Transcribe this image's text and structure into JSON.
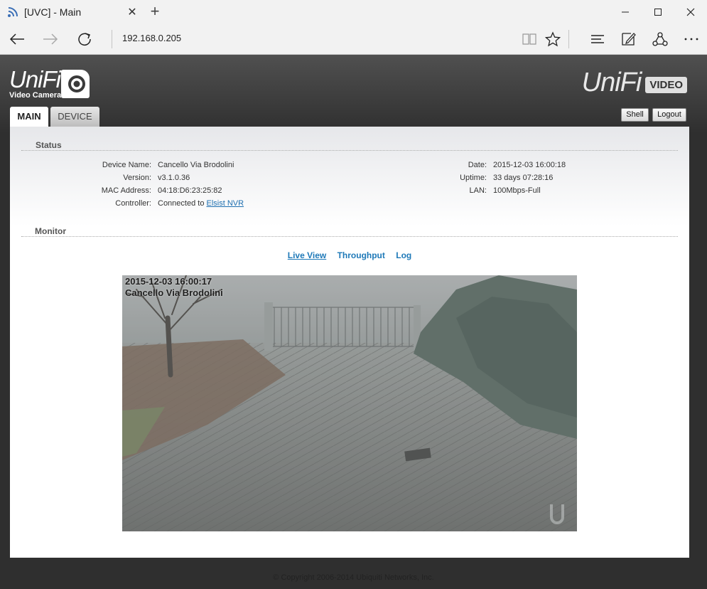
{
  "browser": {
    "tab_title": "[UVC] - Main",
    "tab_close": "✕",
    "new_tab": "+",
    "address": "192.168.0.205"
  },
  "header": {
    "logo_left_text": "UniFi",
    "logo_left_sub": "Video Camera",
    "logo_right_text": "UniFi",
    "logo_right_badge": "VIDEO",
    "shell_label": "Shell",
    "logout_label": "Logout"
  },
  "tabs": {
    "main": "MAIN",
    "device": "DEVICE"
  },
  "status": {
    "title": "Status",
    "device_name_label": "Device Name:",
    "device_name": "Cancello Via Brodolini",
    "version_label": "Version:",
    "version": "v3.1.0.36",
    "mac_label": "MAC Address:",
    "mac": "04:18:D6:23:25:82",
    "controller_label": "Controller:",
    "controller_prefix": "Connected to",
    "controller_link": "Elsist NVR",
    "date_label": "Date:",
    "date": "2015-12-03 16:00:18",
    "uptime_label": "Uptime:",
    "uptime": "33 days 07:28:16",
    "lan_label": "LAN:",
    "lan": "100Mbps-Full"
  },
  "monitor": {
    "title": "Monitor",
    "live_view": "Live View",
    "throughput": "Throughput",
    "log": "Log",
    "osd_time": "2015-12-03 16:00:17",
    "osd_name": "Cancello Via Brodolini"
  },
  "footer": {
    "copyright": "© Copyright 2006-2014 Ubiquiti Networks, Inc."
  },
  "colors": {
    "accent_link": "#1e79b8",
    "header_bg": "#2f2f2f"
  }
}
